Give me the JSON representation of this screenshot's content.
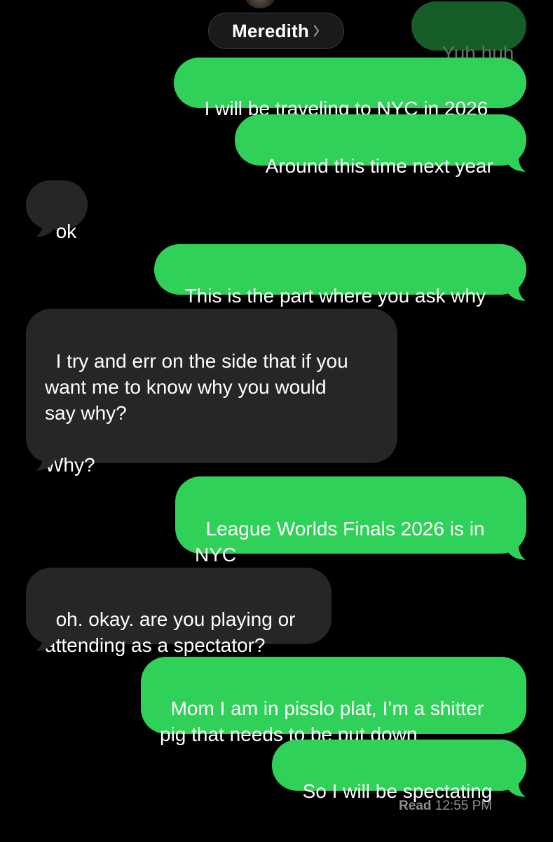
{
  "header": {
    "contact_name": "Meredith",
    "chevron_icon": "chevron-right-icon"
  },
  "messages": [
    {
      "direction": "sent",
      "text": "Yuh huh"
    },
    {
      "direction": "sent",
      "text": "I will be traveling to NYC in 2026"
    },
    {
      "direction": "sent",
      "text": "Around this time next year"
    },
    {
      "direction": "received",
      "text": "ok"
    },
    {
      "direction": "sent",
      "text": "This is the part where you ask why"
    },
    {
      "direction": "received",
      "text": "I try and err on the side that if you\nwant me to know why you would\nsay why?\n\nWhy?"
    },
    {
      "direction": "sent",
      "text": "League Worlds Finals 2026 is in\nNYC"
    },
    {
      "direction": "received",
      "text": "oh. okay. are you playing or\nattending as a spectator?"
    },
    {
      "direction": "sent",
      "text": "Mom I am in pisslo plat, I’m a shitter\npig that needs to be put down"
    },
    {
      "direction": "sent",
      "text": "So I will be spectating"
    }
  ],
  "receipt": {
    "label": "Read",
    "time": "12:55 PM"
  },
  "colors": {
    "background": "#000000",
    "sent_bubble": "#30d158",
    "received_bubble": "#262629",
    "receipt_text": "#8e8e93"
  }
}
